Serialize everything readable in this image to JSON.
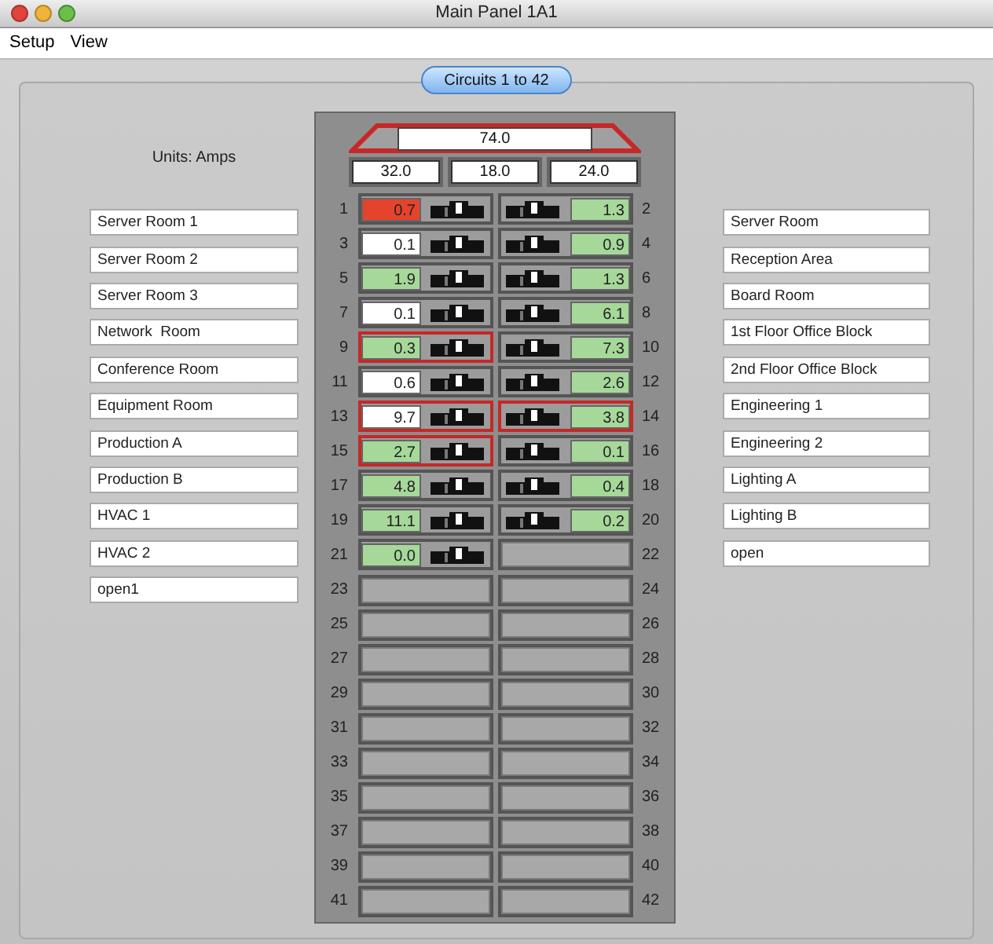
{
  "window": {
    "title": "Main Panel 1A1"
  },
  "menu": [
    {
      "label": "Setup"
    },
    {
      "label": "View"
    }
  ],
  "tab": {
    "label": "Circuits 1 to 42",
    "selected": true
  },
  "units": "Units: Amps",
  "panel": {
    "total": "74.0",
    "phases": [
      "32.0",
      "18.0",
      "24.0"
    ]
  },
  "left_labels": [
    "Server Room 1",
    "Server Room 2",
    "Server Room 3",
    "Network  Room",
    "Conference Room",
    "Equipment Room",
    "Production A",
    "Production B",
    "HVAC 1",
    "HVAC 2",
    "open1"
  ],
  "right_labels": [
    "Server Room",
    "Reception Area",
    "Board Room",
    "1st Floor Office Block",
    "2nd Floor Office Block",
    "Engineering 1",
    "Engineering 2",
    "Lighting A",
    "Lighting B",
    "open"
  ],
  "circuits": [
    {
      "number": "1",
      "kind": "breaker",
      "reading": "0.7",
      "color": "#e6432c",
      "alarm": false
    },
    {
      "number": "2",
      "kind": "breaker",
      "reading": "1.3",
      "color": "#a6d89a",
      "alarm": false
    },
    {
      "number": "3",
      "kind": "breaker",
      "reading": "0.1",
      "color": "#ffffff",
      "alarm": false
    },
    {
      "number": "4",
      "kind": "breaker",
      "reading": "0.9",
      "color": "#a6d89a",
      "alarm": false
    },
    {
      "number": "5",
      "kind": "breaker",
      "reading": "1.9",
      "color": "#a6d89a",
      "alarm": false
    },
    {
      "number": "6",
      "kind": "breaker",
      "reading": "1.3",
      "color": "#a6d89a",
      "alarm": false
    },
    {
      "number": "7",
      "kind": "breaker",
      "reading": "0.1",
      "color": "#ffffff",
      "alarm": false
    },
    {
      "number": "8",
      "kind": "breaker",
      "reading": "6.1",
      "color": "#a6d89a",
      "alarm": false
    },
    {
      "number": "9",
      "kind": "breaker",
      "reading": "0.3",
      "color": "#a6d89a",
      "alarm": true
    },
    {
      "number": "10",
      "kind": "breaker",
      "reading": "7.3",
      "color": "#a6d89a",
      "alarm": false
    },
    {
      "number": "11",
      "kind": "breaker",
      "reading": "0.6",
      "color": "#ffffff",
      "alarm": false
    },
    {
      "number": "12",
      "kind": "breaker",
      "reading": "2.6",
      "color": "#a6d89a",
      "alarm": false
    },
    {
      "number": "13",
      "kind": "breaker",
      "reading": "9.7",
      "color": "#ffffff",
      "alarm": true
    },
    {
      "number": "14",
      "kind": "breaker",
      "reading": "3.8",
      "color": "#a6d89a",
      "alarm": true
    },
    {
      "number": "15",
      "kind": "breaker",
      "reading": "2.7",
      "color": "#a6d89a",
      "alarm": true
    },
    {
      "number": "16",
      "kind": "breaker",
      "reading": "0.1",
      "color": "#a6d89a",
      "alarm": false
    },
    {
      "number": "17",
      "kind": "breaker",
      "reading": "4.8",
      "color": "#a6d89a",
      "alarm": false
    },
    {
      "number": "18",
      "kind": "breaker",
      "reading": "0.4",
      "color": "#a6d89a",
      "alarm": false
    },
    {
      "number": "19",
      "kind": "breaker",
      "reading": "11.1",
      "color": "#a6d89a",
      "alarm": false
    },
    {
      "number": "20",
      "kind": "breaker",
      "reading": "0.2",
      "color": "#a6d89a",
      "alarm": false
    },
    {
      "number": "21",
      "kind": "breaker",
      "reading": "0.0",
      "color": "#a6d89a",
      "alarm": false
    },
    {
      "number": "22",
      "kind": "empty"
    },
    {
      "number": "23",
      "kind": "empty"
    },
    {
      "number": "24",
      "kind": "empty"
    },
    {
      "number": "25",
      "kind": "empty"
    },
    {
      "number": "26",
      "kind": "empty"
    },
    {
      "number": "27",
      "kind": "empty"
    },
    {
      "number": "28",
      "kind": "empty"
    },
    {
      "number": "29",
      "kind": "empty"
    },
    {
      "number": "30",
      "kind": "empty"
    },
    {
      "number": "31",
      "kind": "empty"
    },
    {
      "number": "32",
      "kind": "empty"
    },
    {
      "number": "33",
      "kind": "empty"
    },
    {
      "number": "34",
      "kind": "empty"
    },
    {
      "number": "35",
      "kind": "empty"
    },
    {
      "number": "36",
      "kind": "empty"
    },
    {
      "number": "37",
      "kind": "empty"
    },
    {
      "number": "38",
      "kind": "empty"
    },
    {
      "number": "39",
      "kind": "empty"
    },
    {
      "number": "40",
      "kind": "empty"
    },
    {
      "number": "41",
      "kind": "empty"
    },
    {
      "number": "42",
      "kind": "empty"
    }
  ]
}
